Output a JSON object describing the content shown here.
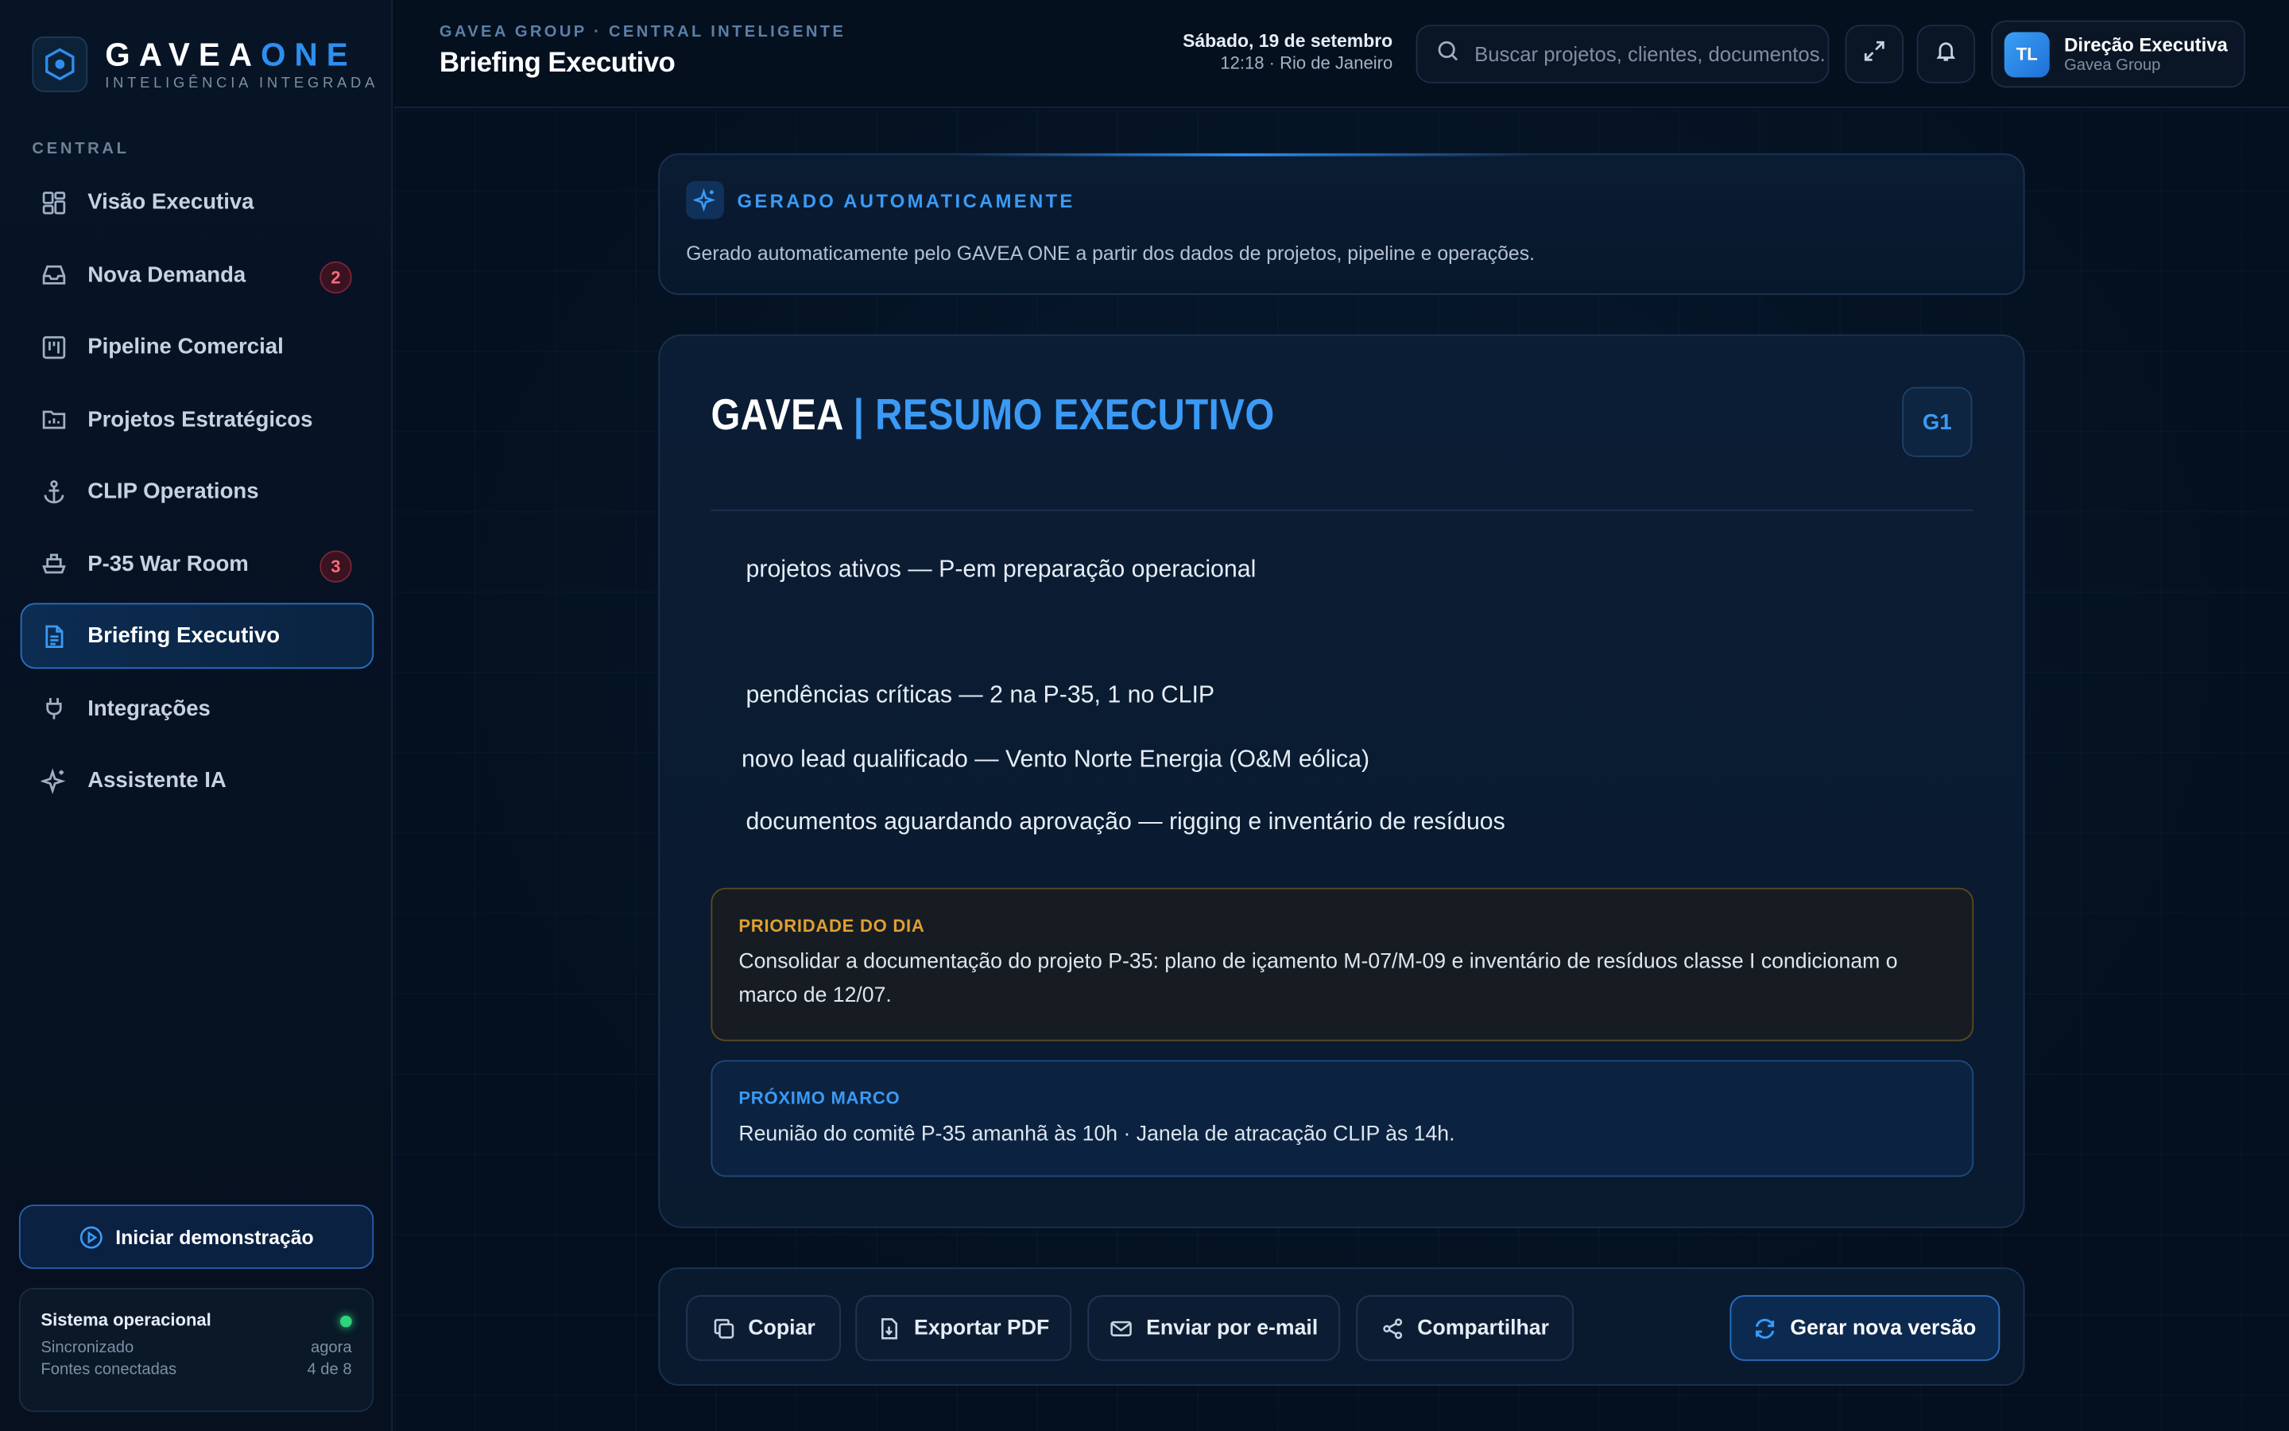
{
  "brand": {
    "name_main": "GAVEA",
    "name_accent": "ONE",
    "subtitle": "INTELIGÊNCIA INTEGRADA"
  },
  "sidebar": {
    "section_label": "CENTRAL",
    "items": [
      {
        "label": "Visão Executiva",
        "icon": "grid-icon"
      },
      {
        "label": "Nova Demanda",
        "icon": "inbox-icon",
        "badge": "2"
      },
      {
        "label": "Pipeline Comercial",
        "icon": "kanban-icon"
      },
      {
        "label": "Projetos Estratégicos",
        "icon": "folder-chart-icon"
      },
      {
        "label": "CLIP Operations",
        "icon": "anchor-icon"
      },
      {
        "label": "P-35 War Room",
        "icon": "ship-icon",
        "badge": "3"
      },
      {
        "label": "Briefing Executivo",
        "icon": "document-icon",
        "active": true
      },
      {
        "label": "Integrações",
        "icon": "plug-icon"
      },
      {
        "label": "Assistente IA",
        "icon": "sparkles-icon"
      }
    ],
    "demo_button": "Iniciar demonstração",
    "status": {
      "title": "Sistema operacional",
      "synced_label": "Sincronizado",
      "synced_value": "agora",
      "sources_label": "Fontes conectadas",
      "sources_value": "4 de 8"
    }
  },
  "header": {
    "breadcrumb": "GAVEA GROUP · CENTRAL INTELIGENTE",
    "title": "Briefing Executivo",
    "date": "Sábado, 19 de setembro",
    "time": "12:18 · Rio de Janeiro",
    "search_placeholder": "Buscar projetos, clientes, documentos...",
    "user_initials": "TL",
    "user_name": "Direção Executiva",
    "user_org": "Gavea Group"
  },
  "auto_banner": {
    "title": "GERADO AUTOMATICAMENTE",
    "text": "Gerado automaticamente pelo GAVEA ONE a partir dos dados de projetos, pipeline e operações."
  },
  "document": {
    "title_main": "GAVEA",
    "title_accent": "| RESUMO EXECUTIVO",
    "tag": "G1",
    "lines": [
      "projetos ativos — P-em preparação operacional",
      "pendências críticas — 2 na P-35, 1 no CLIP",
      "novo lead qualificado — Vento Norte Energia (O&M eólica)",
      "documentos aguardando aprovação — rigging e inventário de resíduos"
    ],
    "priority": {
      "label": "PRIORIDADE DO DIA",
      "text": "Consolidar a documentação do projeto P-35: plano de içamento M-07/M-09 e inventário de resíduos classe I condicionam o marco de 12/07."
    },
    "next": {
      "label": "PRÓXIMO MARCO",
      "text": "Reunião do comitê P-35 amanhã às 10h · Janela de atracação CLIP às 14h."
    }
  },
  "actions": {
    "copy": "Copiar",
    "export_pdf": "Exportar PDF",
    "email": "Enviar por e-mail",
    "share": "Compartilhar",
    "regenerate": "Gerar nova versão"
  },
  "colors": {
    "accent": "#2e8ff0",
    "warning": "#e0a030",
    "success": "#2ed47a",
    "danger": "#f26d7d"
  }
}
